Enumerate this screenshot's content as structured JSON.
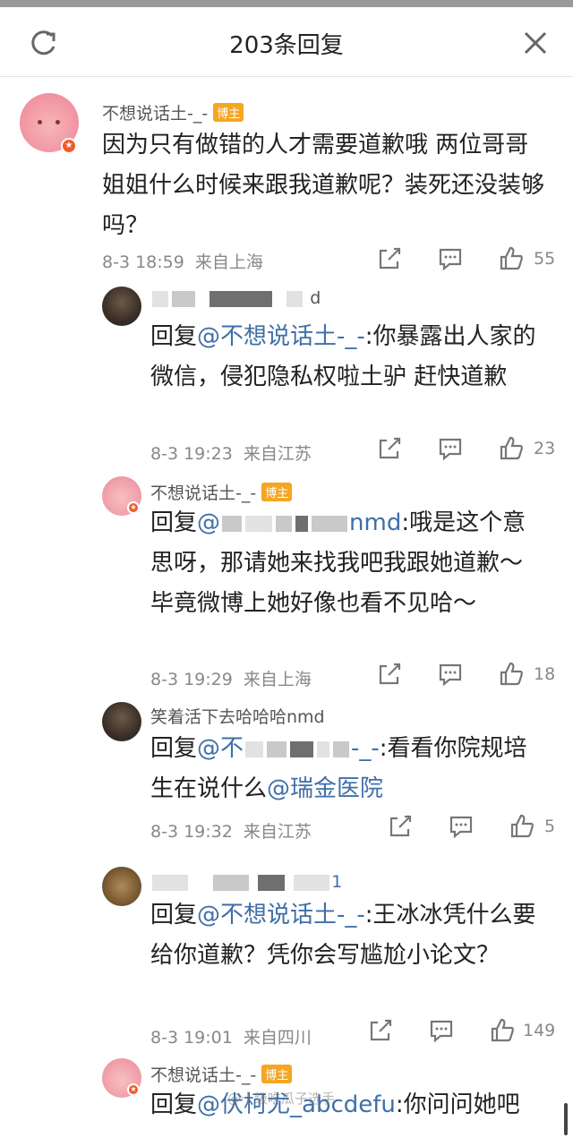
{
  "header": {
    "title": "203条回复",
    "refresh_icon": "refresh-icon",
    "close_icon": "close-icon"
  },
  "badge_label": "博主",
  "main_comment": {
    "author": "不想说话土-_-",
    "text": "因为只有做错的人才需要道歉哦 两位哥哥姐姐什么时候来跟我道歉呢？装死还没装够吗？",
    "time": "8-3 18:59",
    "location": "来自上海",
    "likes": "55"
  },
  "replies": [
    {
      "author_visible": "d",
      "reply_prefix": "回复",
      "mention": "@不想说话土-_-",
      "text": ":你暴露出人家的微信，侵犯隐私权啦土驴 赶快道歉",
      "time": "8-3 19:23",
      "location": "来自江苏",
      "likes": "23"
    },
    {
      "author": "不想说话土-_-",
      "reply_prefix": "回复",
      "mention": "@",
      "mention_tail": "nmd",
      "text": ":哦是这个意思呀，那请她来找我吧我跟她道歉～毕竟微博上她好像也看不见哈～",
      "time": "8-3 19:29",
      "location": "来自上海",
      "likes": "18"
    },
    {
      "author": "笑着活下去哈哈哈nmd",
      "reply_prefix": "回复",
      "mention": "@不",
      "mention_tail": "-_-",
      "text": ":看看你院规培生在说什么",
      "mention2": "@瑞金医院",
      "time": "8-3 19:32",
      "location": "来自江苏",
      "likes": "5"
    },
    {
      "author_visible": "1",
      "reply_prefix": "回复",
      "mention": "@不想说话土-_-",
      "text": ":王冰冰凭什么要给你道歉？凭你会写尴尬小论文？",
      "time": "8-3 19:01",
      "location": "来自四川",
      "likes": "149"
    },
    {
      "author": "不想说话土-_-",
      "reply_prefix": "回复",
      "mention": "@伏柯尤_abcdefu",
      "text": ":你问问她吧"
    }
  ],
  "watermark": "@十级吃瓜子选手",
  "colors": {
    "mention": "#3f6fa8",
    "badge": "#f5a623",
    "vip": "#f25a2a"
  },
  "icons": {
    "share": "share-icon",
    "comment": "comment-icon",
    "like": "thumbs-up-icon"
  }
}
